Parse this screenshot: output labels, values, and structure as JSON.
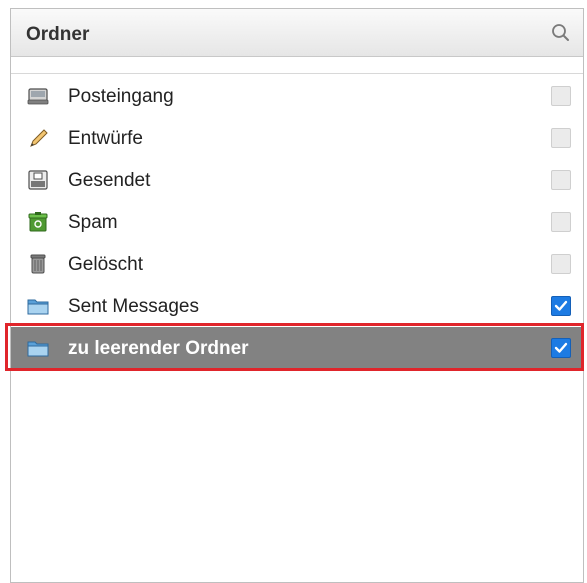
{
  "panel": {
    "title": "Ordner",
    "search_icon": "search-icon"
  },
  "folders": [
    {
      "label": "Posteingang",
      "icon": "inbox-icon",
      "checked": false,
      "selected": false
    },
    {
      "label": "Entwürfe",
      "icon": "pencil-icon",
      "checked": false,
      "selected": false
    },
    {
      "label": "Gesendet",
      "icon": "sent-icon",
      "checked": false,
      "selected": false
    },
    {
      "label": "Spam",
      "icon": "spam-icon",
      "checked": false,
      "selected": false
    },
    {
      "label": "Gelöscht",
      "icon": "trash-icon",
      "checked": false,
      "selected": false
    },
    {
      "label": "Sent Messages",
      "icon": "folder-icon",
      "checked": true,
      "selected": false
    },
    {
      "label": "zu leerender Ordner",
      "icon": "folder-icon",
      "checked": true,
      "selected": true
    }
  ],
  "colors": {
    "selected_row": "#828282",
    "checkbox_checked": "#1d7be3",
    "highlight": "#e0252b"
  }
}
